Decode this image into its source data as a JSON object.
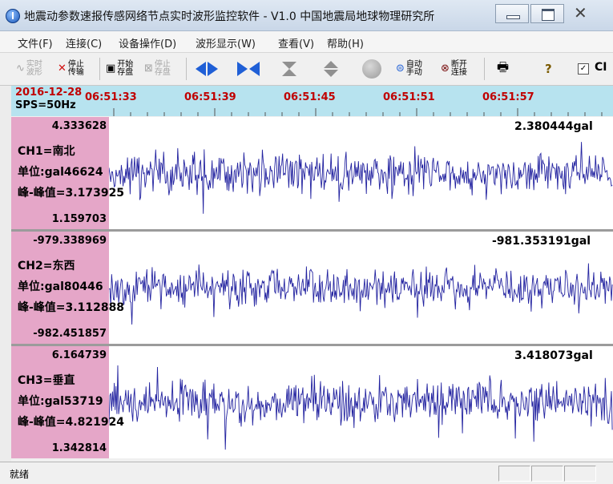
{
  "window": {
    "title": "地震动参数速报传感网络节点实时波形监控软件 - V1.0   中国地震局地球物理研究所",
    "close_glyph": "✕"
  },
  "menu": [
    "文件(F)",
    "连接(C)",
    "设备操作(D)",
    "波形显示(W)",
    "查看(V)",
    "帮助(H)"
  ],
  "toolbar": {
    "realtime_wave": "实时波形",
    "stop_transfer": "停止传输",
    "start_save": "开始存盘",
    "stop_save": "停止存盘",
    "auto_manual": "自动手动",
    "disconnect": "断开连接",
    "printer_glyph": "🖶",
    "help_glyph": "?",
    "check_mark": "✓",
    "checkbox_label": "CI"
  },
  "time_axis": {
    "date": "2016-12-28",
    "sps": "SPS=50Hz",
    "ticks": [
      "06:51:33",
      "06:51:39",
      "06:51:45",
      "06:51:51",
      "06:51:57"
    ]
  },
  "channels": [
    {
      "max": "4.333628",
      "name": "CH1=南北",
      "unit": "单位:gal46624",
      "pp": "峰-峰值=3.173925",
      "min": "1.159703",
      "current": "2.380444gal"
    },
    {
      "max": "-979.338969",
      "name": "CH2=东西",
      "unit": "单位:gal80446",
      "pp": "峰-峰值=3.112888",
      "min": "-982.451857",
      "current": "-981.353191gal"
    },
    {
      "max": "6.164739",
      "name": "CH3=垂直",
      "unit": "单位:gal53719",
      "pp": "峰-峰值=4.821924",
      "min": "1.342814",
      "current": "3.418073gal"
    }
  ],
  "colors": {
    "wave": "#2323a0",
    "label_panel": "#e5a6c8",
    "axis_band": "#b7e3ef",
    "tick_text": "#c00000"
  },
  "status": {
    "text": "就绪"
  }
}
